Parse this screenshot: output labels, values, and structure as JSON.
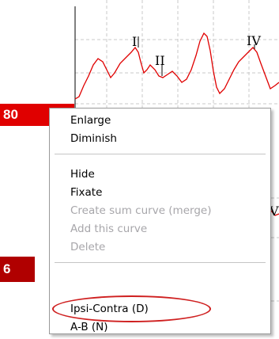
{
  "chart": {
    "peak_labels": [
      "I",
      "II",
      "IV",
      "V"
    ],
    "curve_color": "#e00000",
    "grid_color": "#c8c8c8"
  },
  "level_badges": {
    "upper": "80",
    "lower": "6",
    "color": "#e00000"
  },
  "context_menu": {
    "groups": [
      [
        {
          "label": "Enlarge",
          "enabled": true
        },
        {
          "label": "Diminish",
          "enabled": true
        }
      ],
      [
        {
          "label": "Hide",
          "enabled": true
        },
        {
          "label": "Fixate",
          "enabled": true
        },
        {
          "label": "Create sum curve (merge)",
          "enabled": false
        },
        {
          "label": "Add this curve",
          "enabled": false
        },
        {
          "label": "Delete",
          "enabled": false
        }
      ],
      [
        {
          "label": "Ipsi-Contra (D)",
          "enabled": true,
          "highlighted": true
        },
        {
          "label": "A-B (N)",
          "enabled": true
        }
      ]
    ],
    "highlight_color": "#cf2020"
  }
}
